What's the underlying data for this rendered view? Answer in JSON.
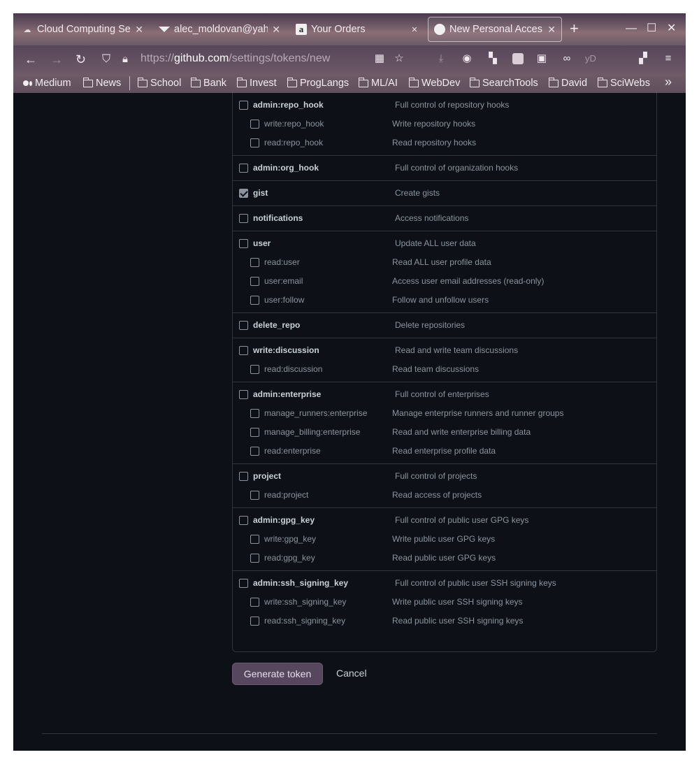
{
  "browser": {
    "tabs": [
      {
        "title": "Cloud Computing Se",
        "favicon": "cloud-icon"
      },
      {
        "title": "alec_moldovan@yah",
        "favicon": "mail-icon"
      },
      {
        "title": "Your Orders",
        "favicon": "amazon-icon"
      },
      {
        "title": "",
        "favicon": "speaker-icon"
      },
      {
        "title": "New Personal Acces",
        "favicon": "github-icon",
        "active": true
      }
    ],
    "url": {
      "scheme": "https://",
      "host": "github.com",
      "path": "/settings/tokens/new"
    },
    "bookmarks": [
      "Medium",
      "News",
      "School",
      "Bank",
      "Invest",
      "ProgLangs",
      "ML/AI",
      "WebDev",
      "SearchTools",
      "David",
      "SciWebs"
    ],
    "toolbar_profile_text": "yD"
  },
  "scopes": [
    {
      "name": "admin:repo_hook",
      "desc": "Full control of repository hooks",
      "checked": false,
      "children": [
        {
          "name": "write:repo_hook",
          "desc": "Write repository hooks"
        },
        {
          "name": "read:repo_hook",
          "desc": "Read repository hooks"
        }
      ]
    },
    {
      "name": "admin:org_hook",
      "desc": "Full control of organization hooks",
      "checked": false,
      "children": []
    },
    {
      "name": "gist",
      "desc": "Create gists",
      "checked": true,
      "children": []
    },
    {
      "name": "notifications",
      "desc": "Access notifications",
      "checked": false,
      "children": []
    },
    {
      "name": "user",
      "desc": "Update ALL user data",
      "checked": false,
      "children": [
        {
          "name": "read:user",
          "desc": "Read ALL user profile data"
        },
        {
          "name": "user:email",
          "desc": "Access user email addresses (read-only)"
        },
        {
          "name": "user:follow",
          "desc": "Follow and unfollow users"
        }
      ]
    },
    {
      "name": "delete_repo",
      "desc": "Delete repositories",
      "checked": false,
      "children": []
    },
    {
      "name": "write:discussion",
      "desc": "Read and write team discussions",
      "checked": false,
      "children": [
        {
          "name": "read:discussion",
          "desc": "Read team discussions"
        }
      ]
    },
    {
      "name": "admin:enterprise",
      "desc": "Full control of enterprises",
      "checked": false,
      "children": [
        {
          "name": "manage_runners:enterprise",
          "desc": "Manage enterprise runners and runner groups"
        },
        {
          "name": "manage_billing:enterprise",
          "desc": "Read and write enterprise billing data"
        },
        {
          "name": "read:enterprise",
          "desc": "Read enterprise profile data"
        }
      ]
    },
    {
      "name": "project",
      "desc": "Full control of projects",
      "checked": false,
      "children": [
        {
          "name": "read:project",
          "desc": "Read access of projects"
        }
      ]
    },
    {
      "name": "admin:gpg_key",
      "desc": "Full control of public user GPG keys",
      "checked": false,
      "children": [
        {
          "name": "write:gpg_key",
          "desc": "Write public user GPG keys"
        },
        {
          "name": "read:gpg_key",
          "desc": "Read public user GPG keys"
        }
      ]
    },
    {
      "name": "admin:ssh_signing_key",
      "desc": "Full control of public user SSH signing keys",
      "checked": false,
      "children": [
        {
          "name": "write:ssh_signing_key",
          "desc": "Write public user SSH signing keys"
        },
        {
          "name": "read:ssh_signing_key",
          "desc": "Read public user SSH signing keys"
        }
      ]
    }
  ],
  "actions": {
    "generate_label": "Generate token",
    "cancel_label": "Cancel"
  }
}
